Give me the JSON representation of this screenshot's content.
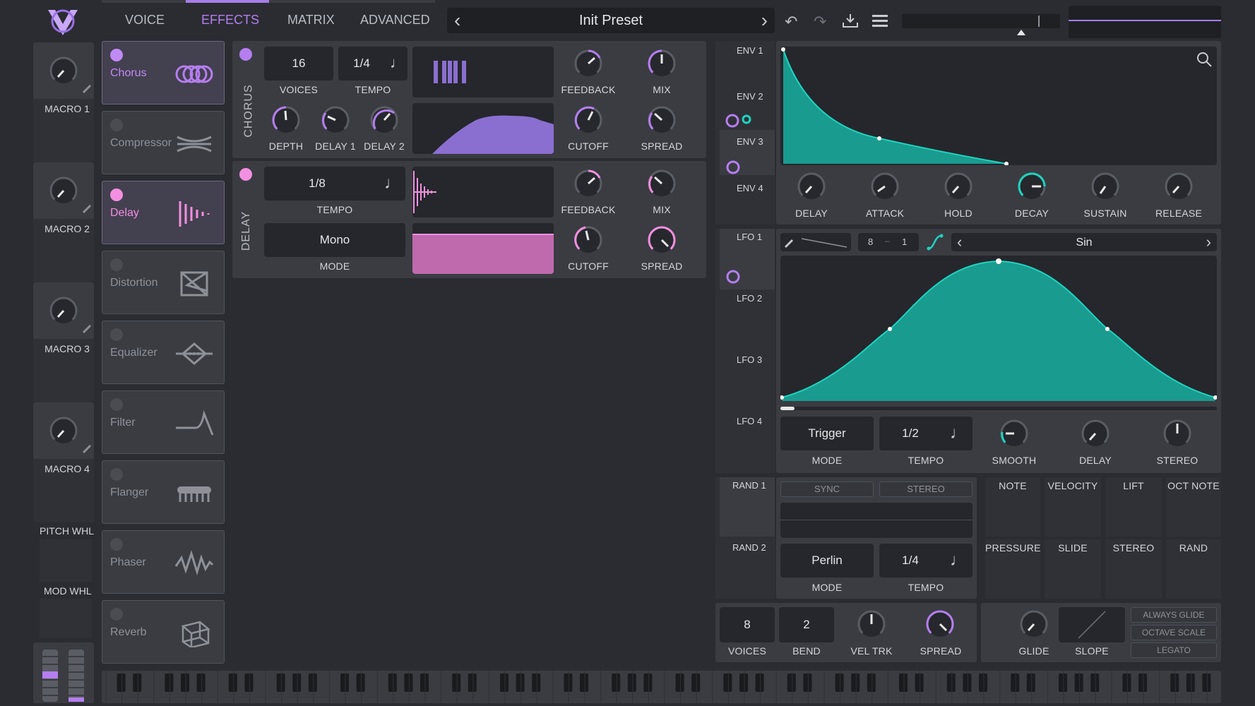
{
  "tabs": [
    "VOICE",
    "EFFECTS",
    "MATRIX",
    "ADVANCED"
  ],
  "active_tab": "EFFECTS",
  "preset": {
    "name": "Init Preset",
    "prev": "‹",
    "next": "›"
  },
  "macros": [
    "MACRO 1",
    "MACRO 2",
    "MACRO 3",
    "MACRO 4"
  ],
  "wheels": {
    "pitch": "PITCH WHL",
    "mod": "MOD WHL"
  },
  "effects": [
    {
      "name": "Chorus",
      "enabled": true,
      "icon": "chorus-icon"
    },
    {
      "name": "Compressor",
      "enabled": false,
      "icon": "compressor-icon"
    },
    {
      "name": "Delay",
      "enabled": true,
      "icon": "delay-icon"
    },
    {
      "name": "Distortion",
      "enabled": false,
      "icon": "distortion-icon"
    },
    {
      "name": "Equalizer",
      "enabled": false,
      "icon": "equalizer-icon"
    },
    {
      "name": "Filter",
      "enabled": false,
      "icon": "filter-icon"
    },
    {
      "name": "Flanger",
      "enabled": false,
      "icon": "flanger-icon"
    },
    {
      "name": "Phaser",
      "enabled": false,
      "icon": "phaser-icon"
    },
    {
      "name": "Reverb",
      "enabled": false,
      "icon": "reverb-icon"
    }
  ],
  "chorus": {
    "title": "CHORUS",
    "voices": "16",
    "voices_label": "VOICES",
    "tempo": "1/4",
    "tempo_label": "TEMPO",
    "labels": {
      "feedback": "FEEDBACK",
      "mix": "MIX",
      "depth": "DEPTH",
      "delay1": "DELAY 1",
      "delay2": "DELAY 2",
      "cutoff": "CUTOFF",
      "spread": "SPREAD"
    }
  },
  "delay": {
    "title": "DELAY",
    "tempo": "1/8",
    "tempo_label": "TEMPO",
    "mode": "Mono",
    "mode_label": "MODE",
    "labels": {
      "feedback": "FEEDBACK",
      "mix": "MIX",
      "cutoff": "CUTOFF",
      "spread": "SPREAD"
    }
  },
  "env": {
    "names": [
      "ENV 1",
      "ENV 2",
      "ENV 3",
      "ENV 4"
    ],
    "knobs": [
      "DELAY",
      "ATTACK",
      "HOLD",
      "DECAY",
      "SUSTAIN",
      "RELEASE"
    ]
  },
  "lfo": {
    "names": [
      "LFO 1",
      "LFO 2",
      "LFO 3",
      "LFO 4"
    ],
    "grid_x": "8",
    "grid_y": "1",
    "shape": "Sin",
    "mode": "Trigger",
    "mode_label": "MODE",
    "tempo": "1/2",
    "tempo_label": "TEMPO",
    "knobs": [
      "SMOOTH",
      "DELAY",
      "STEREO"
    ]
  },
  "rand": {
    "names": [
      "RAND 1",
      "RAND 2"
    ],
    "sync": "SYNC",
    "stereo": "STEREO",
    "mode": "Perlin",
    "mode_label": "MODE",
    "tempo": "1/4",
    "tempo_label": "TEMPO"
  },
  "sources": [
    "NOTE",
    "VELOCITY",
    "LIFT",
    "OCT NOTE",
    "PRESSURE",
    "SLIDE",
    "STEREO",
    "RAND"
  ],
  "voice_ctrl": {
    "voices": "8",
    "voices_label": "VOICES",
    "bend": "2",
    "bend_label": "BEND",
    "veltrk": "VEL TRK",
    "spread": "SPREAD",
    "glide": "GLIDE",
    "slope": "SLOPE"
  },
  "glide_opts": [
    "ALWAYS GLIDE",
    "OCTAVE SCALE",
    "LEGATO"
  ],
  "colors": {
    "purple": "#b57ef0",
    "teal": "#1fd3c0",
    "pink": "#f38fe0",
    "bg": "#2a2c31"
  }
}
